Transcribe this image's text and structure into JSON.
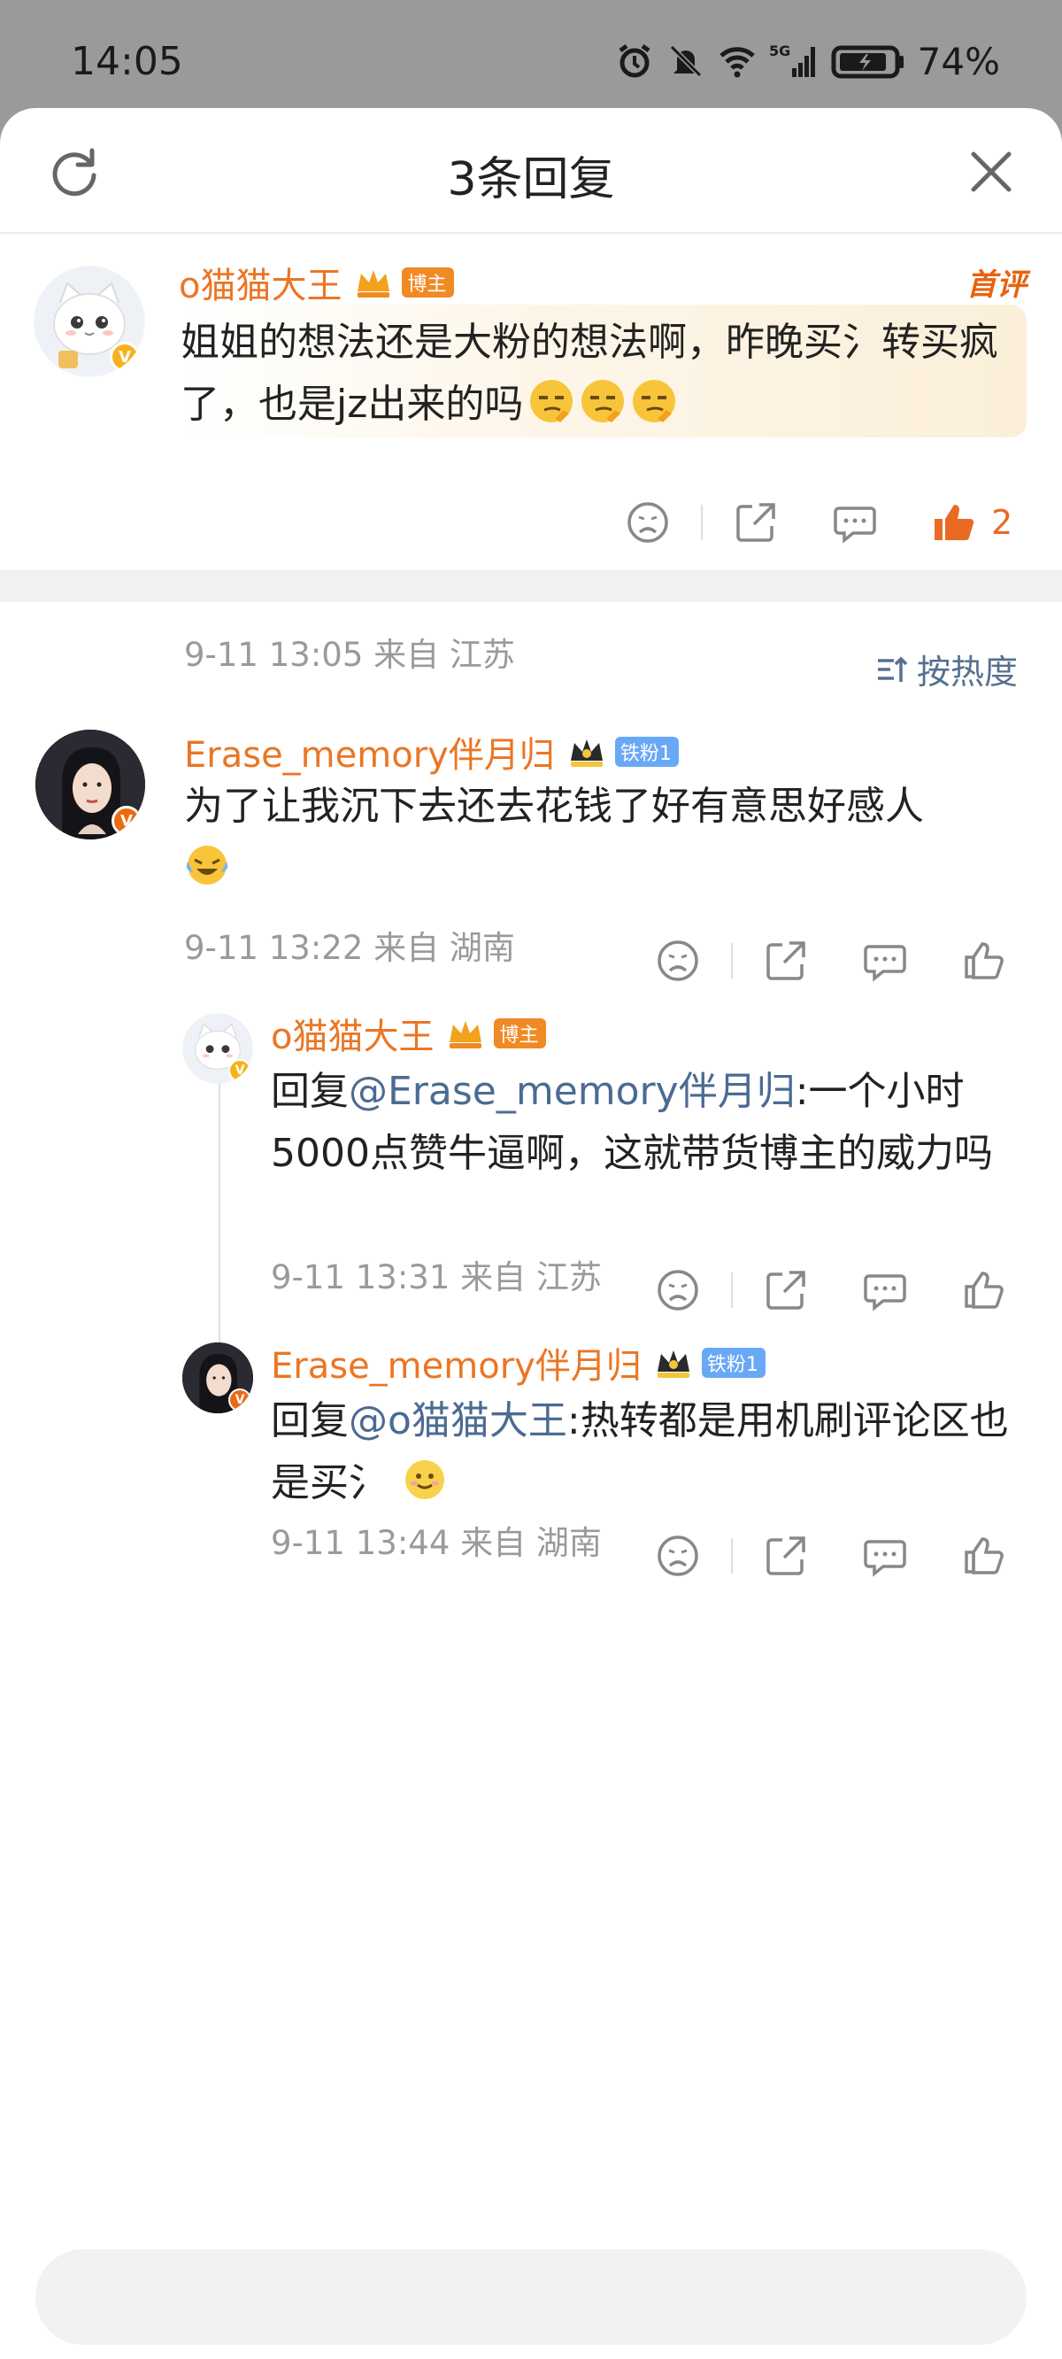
{
  "status": {
    "time": "14:05",
    "battery": "74%",
    "network": "5G"
  },
  "sheet": {
    "title": "3条回复"
  },
  "root_comment": {
    "user": "o猫猫大王",
    "tag": "博主",
    "badge": "首评",
    "text": "姐姐的想法还是大粉的想法啊，昨晚买氵转买疯了，也是jz出来的吗",
    "date": "9-11 13:05",
    "location": "来自 江苏",
    "likes": "2"
  },
  "sort": {
    "label": "按热度"
  },
  "comments": [
    {
      "user": "Erase_memory伴月归",
      "tag": "铁粉1",
      "text": "为了让我沉下去还去花钱了好有意思好感人",
      "date": "9-11 13:22",
      "location": "来自 湖南"
    },
    {
      "user": "o猫猫大王",
      "tag": "博主",
      "reply_prefix": "回复",
      "mention": "@Erase_memory伴月归",
      "text": ":一个小时5000点赞牛逼啊，这就带货博主的威力吗",
      "date": "9-11 13:31",
      "location": "来自 江苏"
    },
    {
      "user": "Erase_memory伴月归",
      "tag": "铁粉1",
      "reply_prefix": "回复",
      "mention": "@o猫猫大王",
      "text": ":热转都是用机刷评论区也是买氵",
      "date": "9-11 13:44",
      "location": "来自 湖南"
    }
  ],
  "colors": {
    "username": "#eb7624",
    "mention": "#4b6b93",
    "meta": "#9a9a9a",
    "like_active": "#e86a25"
  }
}
